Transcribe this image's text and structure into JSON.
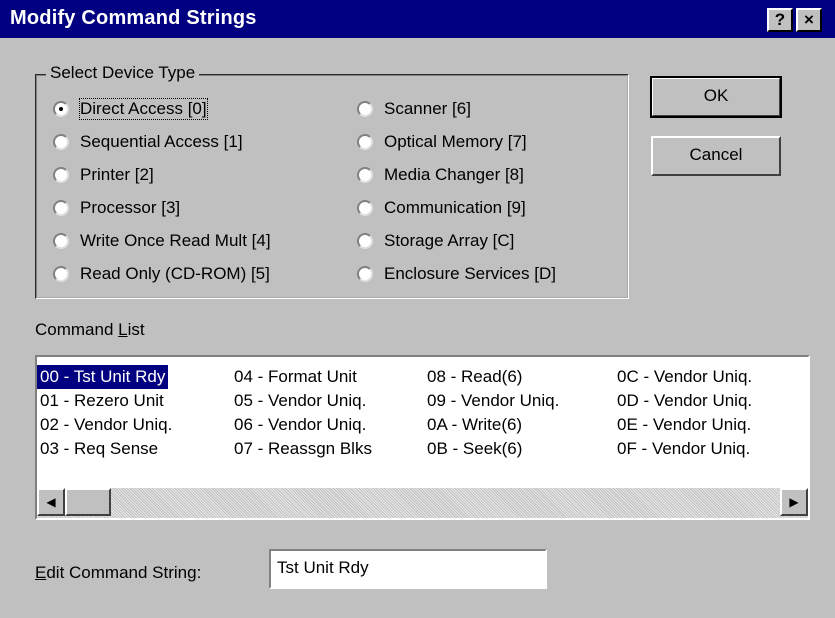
{
  "window": {
    "title": "Modify Command Strings",
    "help_label": "?",
    "close_label": "×"
  },
  "device_type": {
    "group_label": "Select Device Type",
    "selected": "Direct Access [0]",
    "left_column": [
      "Direct Access [0]",
      "Sequential Access [1]",
      "Printer [2]",
      "Processor [3]",
      "Write Once Read Mult [4]",
      "Read Only (CD-ROM) [5]"
    ],
    "right_column": [
      "Scanner [6]",
      "Optical Memory [7]",
      "Media Changer [8]",
      "Communication [9]",
      "Storage Array [C]",
      "Enclosure Services [D]"
    ]
  },
  "buttons": {
    "ok_label": "OK",
    "cancel_label": "Cancel"
  },
  "command_list": {
    "label": "Command List",
    "selected": "00 - Tst Unit Rdy",
    "columns": [
      [
        "00 - Tst Unit Rdy",
        "01 - Rezero Unit",
        "02 - Vendor Uniq.",
        "03 - Req Sense"
      ],
      [
        "04 - Format Unit",
        "05 - Vendor Uniq.",
        "06 - Vendor Uniq.",
        "07 - Reassgn Blks"
      ],
      [
        "08 - Read(6)",
        "09 - Vendor Uniq.",
        "0A - Write(6)",
        "0B - Seek(6)"
      ],
      [
        "0C - Vendor Uniq.",
        "0D - Vendor Uniq.",
        "0E - Vendor Uniq.",
        "0F - Vendor Uniq."
      ]
    ],
    "scroll_left_icon": "◀",
    "scroll_right_icon": "▶"
  },
  "edit": {
    "label": "Edit Command String:",
    "value": "Tst Unit Rdy"
  }
}
